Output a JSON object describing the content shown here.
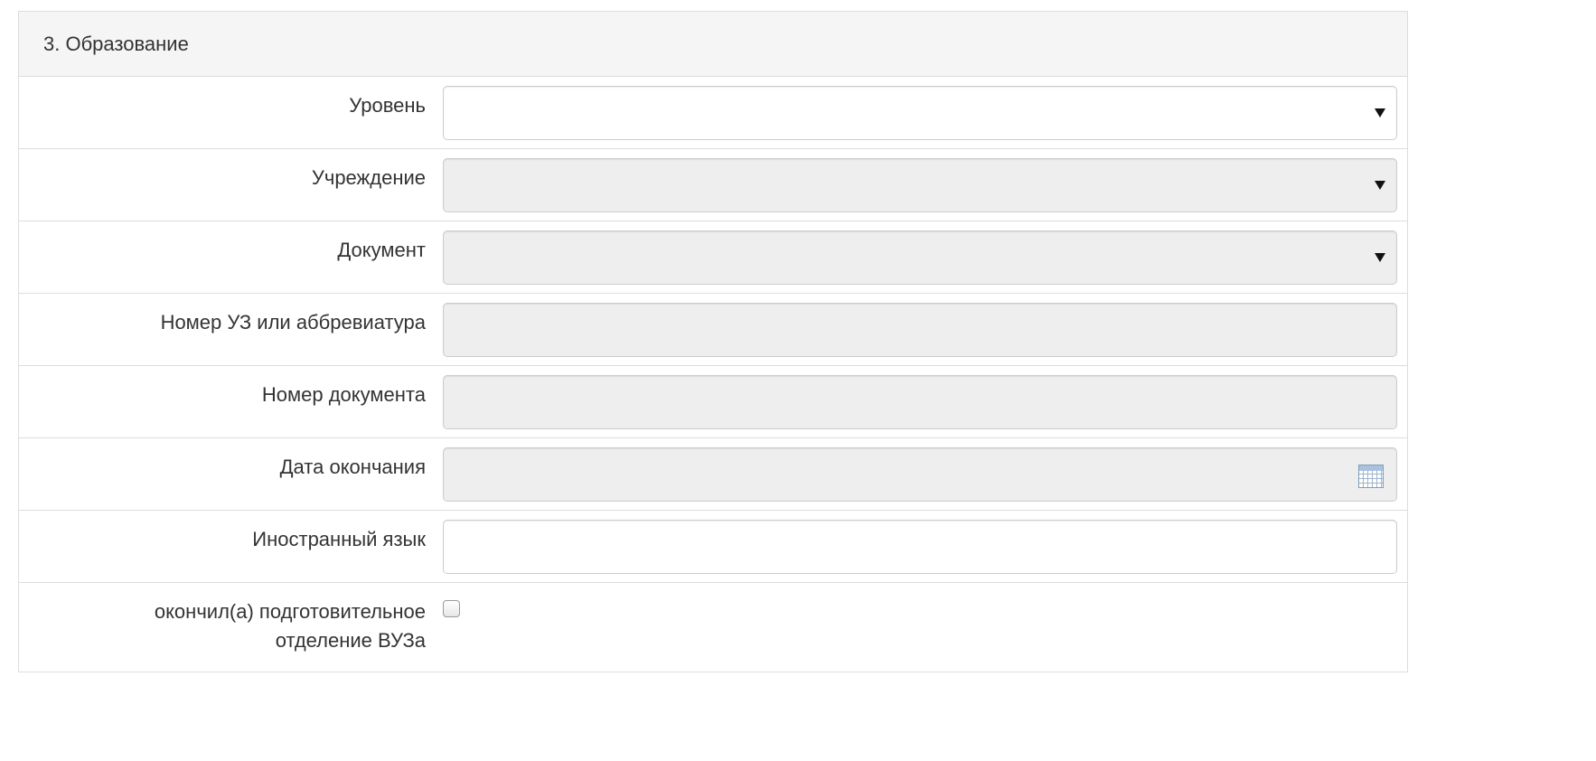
{
  "section": {
    "title": "3. Образование"
  },
  "fields": {
    "level": {
      "label": "Уровень",
      "value": ""
    },
    "institution": {
      "label": "Учреждение",
      "value": ""
    },
    "document": {
      "label": "Документ",
      "value": ""
    },
    "institution_number": {
      "label": "Номер УЗ или аббревиатура",
      "value": ""
    },
    "document_number": {
      "label": "Номер документа",
      "value": ""
    },
    "graduation_date": {
      "label": "Дата окончания",
      "value": ""
    },
    "foreign_language": {
      "label": "Иностранный язык",
      "value": ""
    },
    "prep_department": {
      "label_line1": "окончил(а) подготовительное",
      "label_line2": "отделение ВУЗа",
      "checked": false
    }
  },
  "icons": {
    "select_caret": "chevron-down-icon",
    "date_picker": "calendar-icon"
  },
  "colors": {
    "heading_bg": "#f5f5f5",
    "border": "#dddddd",
    "input_border": "#cccccc",
    "disabled_bg": "#eeeeee"
  }
}
